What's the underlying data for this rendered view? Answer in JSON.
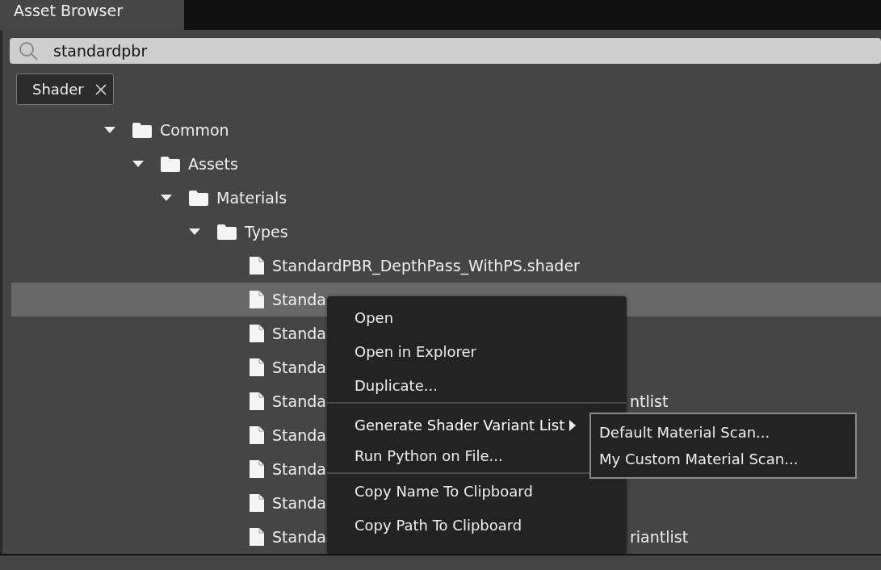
{
  "tab": {
    "title": "Asset Browser",
    "selected": true
  },
  "search": {
    "value": "standardpbr"
  },
  "filters": [
    {
      "label": "Shader"
    }
  ],
  "tree": [
    {
      "kind": "folder",
      "name": "Common",
      "expanded": true,
      "selected": false,
      "children": [
        {
          "kind": "folder",
          "name": "Assets",
          "expanded": true,
          "selected": false,
          "children": [
            {
              "kind": "folder",
              "name": "Materials",
              "expanded": true,
              "selected": false,
              "children": [
                {
                  "kind": "folder",
                  "name": "Types",
                  "expanded": true,
                  "selected": false,
                  "children": [
                    {
                      "kind": "file",
                      "name": "StandardPBR_DepthPass_WithPS.shader",
                      "selected": false
                    },
                    {
                      "kind": "file",
                      "name": "Standa",
                      "selected": true
                    },
                    {
                      "kind": "file",
                      "name": "Standa",
                      "selected": false
                    },
                    {
                      "kind": "file",
                      "name": "Standa",
                      "selected": false
                    },
                    {
                      "kind": "file",
                      "name": "Standa",
                      "tail": "ntlist",
                      "selected": false
                    },
                    {
                      "kind": "file",
                      "name": "Standa",
                      "selected": false
                    },
                    {
                      "kind": "file",
                      "name": "Standa",
                      "selected": false
                    },
                    {
                      "kind": "file",
                      "name": "Standa",
                      "selected": false
                    },
                    {
                      "kind": "file",
                      "name": "Standa",
                      "tail": "riantlist",
                      "selected": false
                    }
                  ]
                }
              ]
            }
          ]
        }
      ]
    }
  ],
  "context_menu": {
    "items": [
      {
        "kind": "action",
        "label": "Open"
      },
      {
        "kind": "action",
        "label": "Open in Explorer"
      },
      {
        "kind": "action",
        "label": "Duplicate..."
      },
      {
        "kind": "separator"
      },
      {
        "kind": "submenu",
        "label": "Generate Shader Variant List",
        "expanded": true,
        "items": [
          {
            "kind": "action",
            "label": "Default Material Scan..."
          },
          {
            "kind": "action",
            "label": "My Custom Material Scan..."
          }
        ]
      },
      {
        "kind": "action",
        "label": "Run Python on File..."
      },
      {
        "kind": "separator"
      },
      {
        "kind": "action",
        "label": "Copy Name To Clipboard"
      },
      {
        "kind": "action",
        "label": "Copy Path To Clipboard"
      }
    ]
  }
}
